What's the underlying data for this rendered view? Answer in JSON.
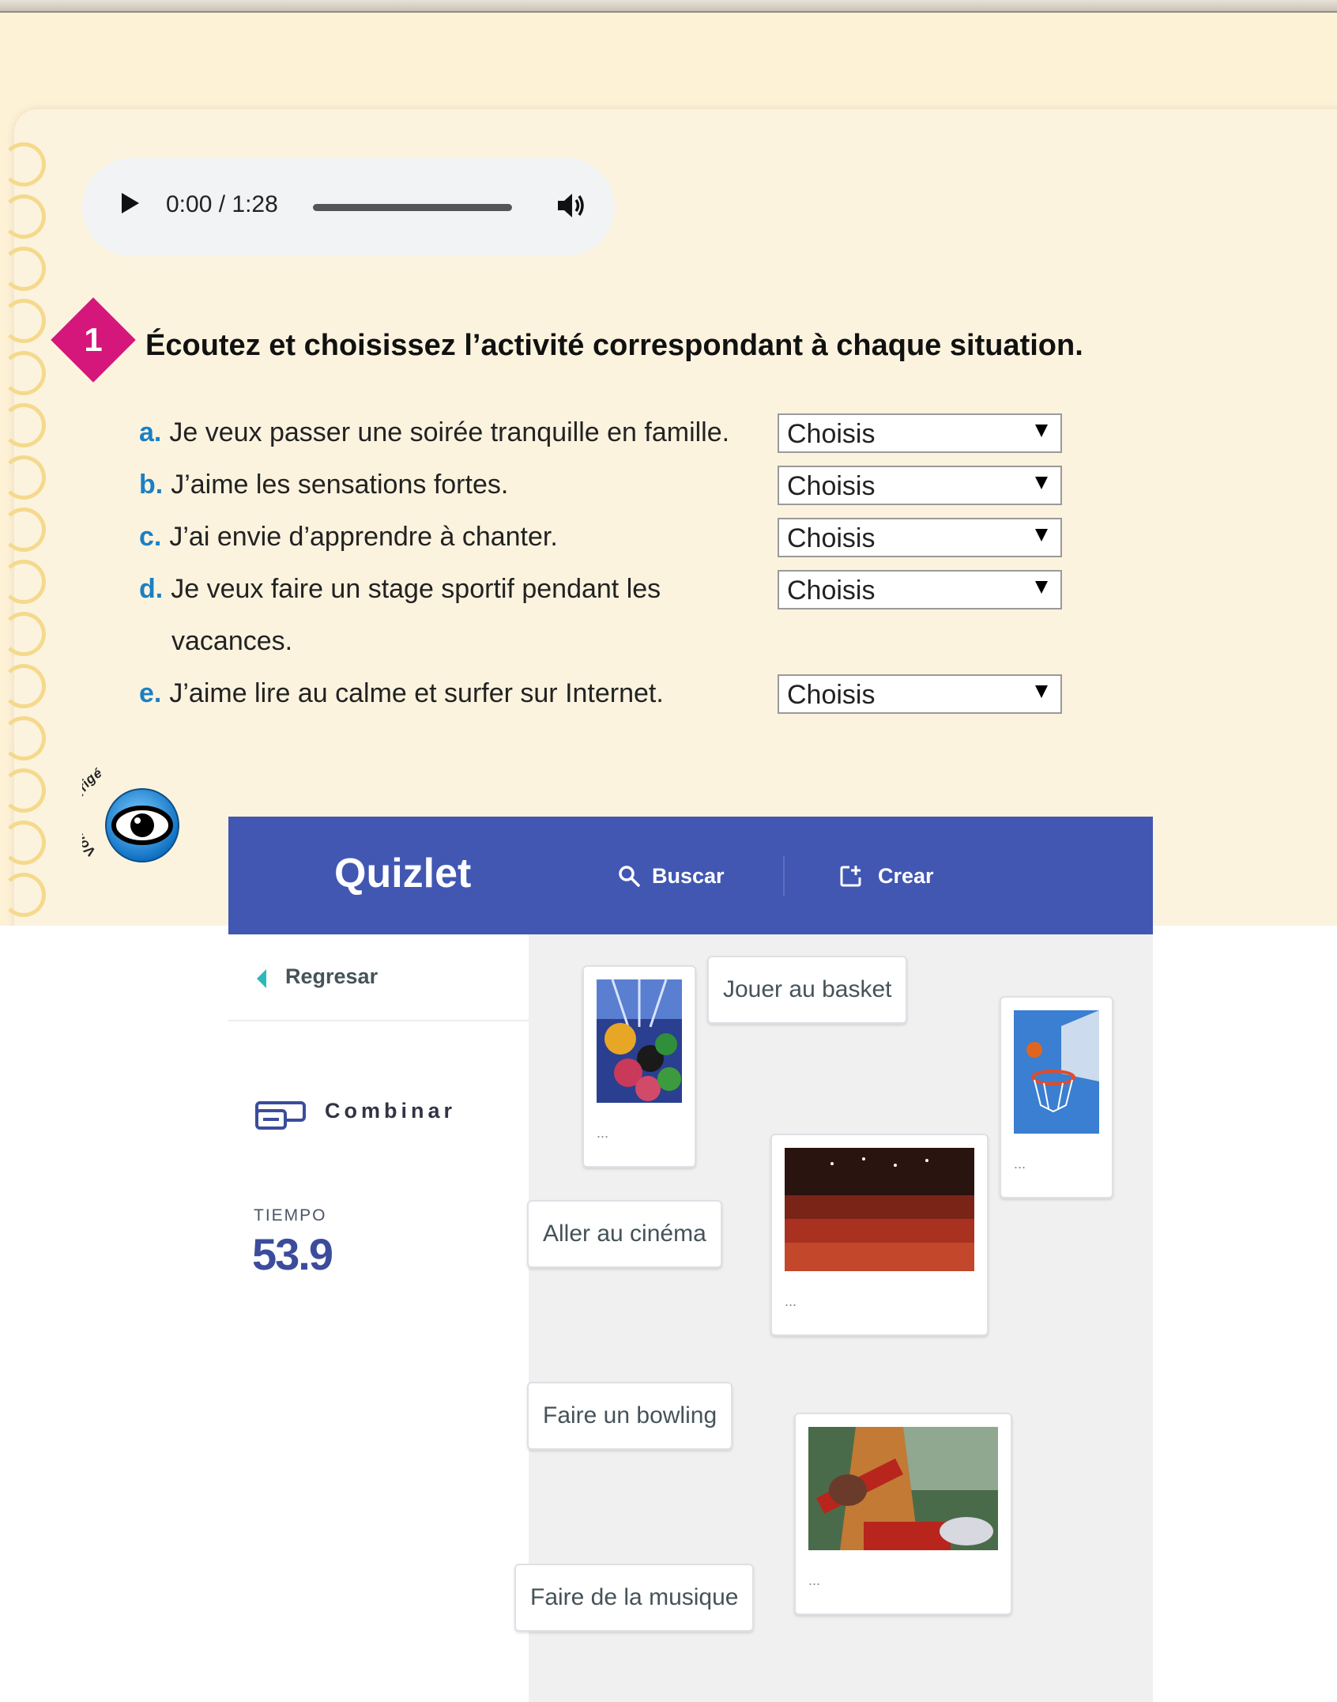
{
  "audio": {
    "time": "0:00 / 1:28"
  },
  "exercise": {
    "number": "1",
    "instruction": "Écoutez et choisissez l’activité correspondant à chaque situation.",
    "select_default": "Choisis",
    "items": [
      {
        "letter": "a.",
        "text": "Je veux passer une soirée tranquille en famille.",
        "selected": "Choisis"
      },
      {
        "letter": "b.",
        "text": "J’aime les sensations fortes.",
        "selected": "Choisis"
      },
      {
        "letter": "c.",
        "text": "J’ai envie d’apprendre à chanter.",
        "selected": "Choisis"
      },
      {
        "letter": "d.",
        "text": "Je veux faire un stage sportif pendant les",
        "continuation": "vacances.",
        "selected": "Choisis"
      },
      {
        "letter": "e.",
        "text": "J’aime lire au calme et surfer sur Internet.",
        "selected": "Choisis"
      }
    ],
    "corrige_label": "Voir le corrigé"
  },
  "quizlet": {
    "logo": "Quizlet",
    "search_label": "Buscar",
    "create_label": "Crear",
    "back_label": "Regresar",
    "mode_label": "Combinar",
    "timer_label": "TIEMPO",
    "timer_value": "53.9",
    "terms": [
      "Jouer au basket",
      "Aller au cinéma",
      "Faire un bowling",
      "Faire de la musique"
    ],
    "image_cards": [
      {
        "icon": "bowling-image",
        "caption": "..."
      },
      {
        "icon": "basketball-image",
        "caption": "..."
      },
      {
        "icon": "cinema-image",
        "caption": "..."
      },
      {
        "icon": "music-image",
        "caption": "..."
      }
    ]
  },
  "colors": {
    "quizlet_blue": "#4257b2",
    "badge_magenta": "#d5177b",
    "letter_blue": "#1a80c4",
    "page_cream": "#fcf3df"
  }
}
